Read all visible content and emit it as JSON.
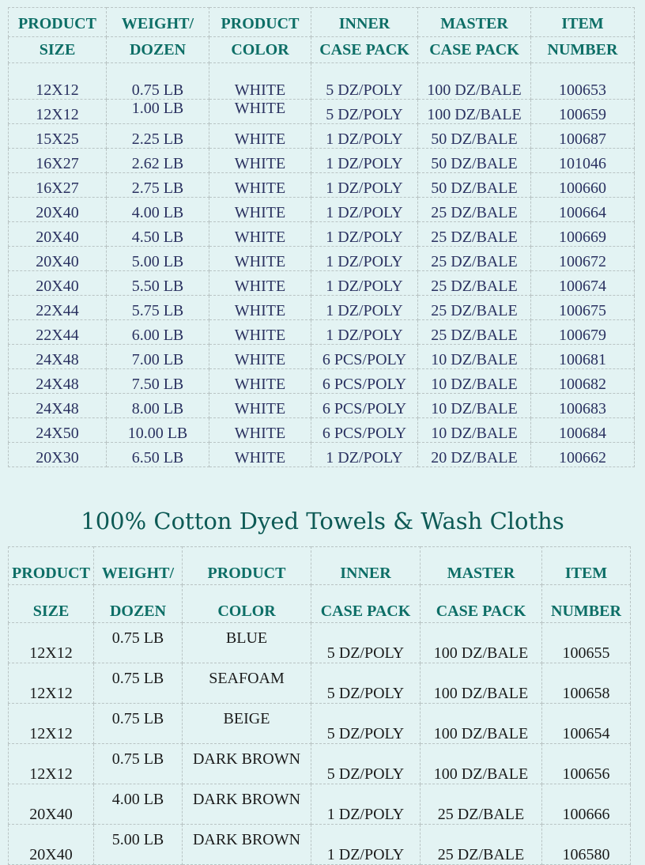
{
  "colors": {
    "background": "#e3f3f3",
    "header_text": "#0d6e66",
    "table1_text": "#2a3160",
    "table2_text": "#1b1b1b",
    "title_text": "#0d5a55",
    "grid_line": "#b9c4c4"
  },
  "table1": {
    "headers_line1": [
      "PRODUCT",
      "WEIGHT/",
      "PRODUCT",
      "INNER",
      "MASTER",
      "ITEM"
    ],
    "headers_line2": [
      "SIZE",
      "DOZEN",
      "COLOR",
      "CASE PACK",
      "CASE PACK",
      "NUMBER"
    ],
    "rows": [
      [
        "12X12",
        "0.75 LB",
        "WHITE",
        "5 DZ/POLY",
        "100 DZ/BALE",
        "100653"
      ],
      [
        "12X12",
        "1.00 LB",
        "WHITE",
        "5 DZ/POLY",
        "100 DZ/BALE",
        "100659"
      ],
      [
        "15X25",
        "2.25 LB",
        "WHITE",
        "1 DZ/POLY",
        "50 DZ/BALE",
        "100687"
      ],
      [
        "16X27",
        "2.62 LB",
        "WHITE",
        "1 DZ/POLY",
        "50 DZ/BALE",
        "101046"
      ],
      [
        "16X27",
        "2.75 LB",
        "WHITE",
        "1 DZ/POLY",
        "50 DZ/BALE",
        "100660"
      ],
      [
        "20X40",
        "4.00 LB",
        "WHITE",
        "1 DZ/POLY",
        "25 DZ/BALE",
        "100664"
      ],
      [
        "20X40",
        "4.50 LB",
        "WHITE",
        "1 DZ/POLY",
        "25 DZ/BALE",
        "100669"
      ],
      [
        "20X40",
        "5.00 LB",
        "WHITE",
        "1 DZ/POLY",
        "25 DZ/BALE",
        "100672"
      ],
      [
        "20X40",
        "5.50 LB",
        "WHITE",
        "1 DZ/POLY",
        "25 DZ/BALE",
        "100674"
      ],
      [
        "22X44",
        "5.75 LB",
        "WHITE",
        "1 DZ/POLY",
        "25 DZ/BALE",
        "100675"
      ],
      [
        "22X44",
        "6.00 LB",
        "WHITE",
        "1 DZ/POLY",
        "25 DZ/BALE",
        "100679"
      ],
      [
        "24X48",
        "7.00 LB",
        "WHITE",
        "6 PCS/POLY",
        "10 DZ/BALE",
        "100681"
      ],
      [
        "24X48",
        "7.50 LB",
        "WHITE",
        "6 PCS/POLY",
        "10 DZ/BALE",
        "100682"
      ],
      [
        "24X48",
        "8.00 LB",
        "WHITE",
        "6 PCS/POLY",
        "10 DZ/BALE",
        "100683"
      ],
      [
        "24X50",
        "10.00 LB",
        "WHITE",
        "6 PCS/POLY",
        "10 DZ/BALE",
        "100684"
      ],
      [
        "20X30",
        "6.50 LB",
        "WHITE",
        "1 DZ/POLY",
        "20 DZ/BALE",
        "100662"
      ]
    ]
  },
  "section_title": "100%  Cotton Dyed Towels & Wash Cloths",
  "table2": {
    "headers_line1": [
      "PRODUCT",
      "WEIGHT/",
      "PRODUCT",
      "INNER",
      "MASTER",
      "ITEM"
    ],
    "headers_line2": [
      "SIZE",
      "DOZEN",
      "COLOR",
      "CASE PACK",
      "CASE PACK",
      "NUMBER"
    ],
    "rows": [
      [
        "12X12",
        "0.75 LB",
        "BLUE",
        "5 DZ/POLY",
        "100 DZ/BALE",
        "100655"
      ],
      [
        "12X12",
        "0.75 LB",
        "SEAFOAM",
        "5 DZ/POLY",
        "100 DZ/BALE",
        "100658"
      ],
      [
        "12X12",
        "0.75 LB",
        "BEIGE",
        "5 DZ/POLY",
        "100 DZ/BALE",
        "100654"
      ],
      [
        "12X12",
        "0.75 LB",
        "DARK BROWN",
        "5 DZ/POLY",
        "100 DZ/BALE",
        "100656"
      ],
      [
        "20X40",
        "4.00 LB",
        "DARK BROWN",
        "1 DZ/POLY",
        "25 DZ/BALE",
        "100666"
      ],
      [
        "20X40",
        "5.00 LB",
        "DARK BROWN",
        "1 DZ/POLY",
        "25 DZ/BALE",
        "106580"
      ]
    ]
  }
}
